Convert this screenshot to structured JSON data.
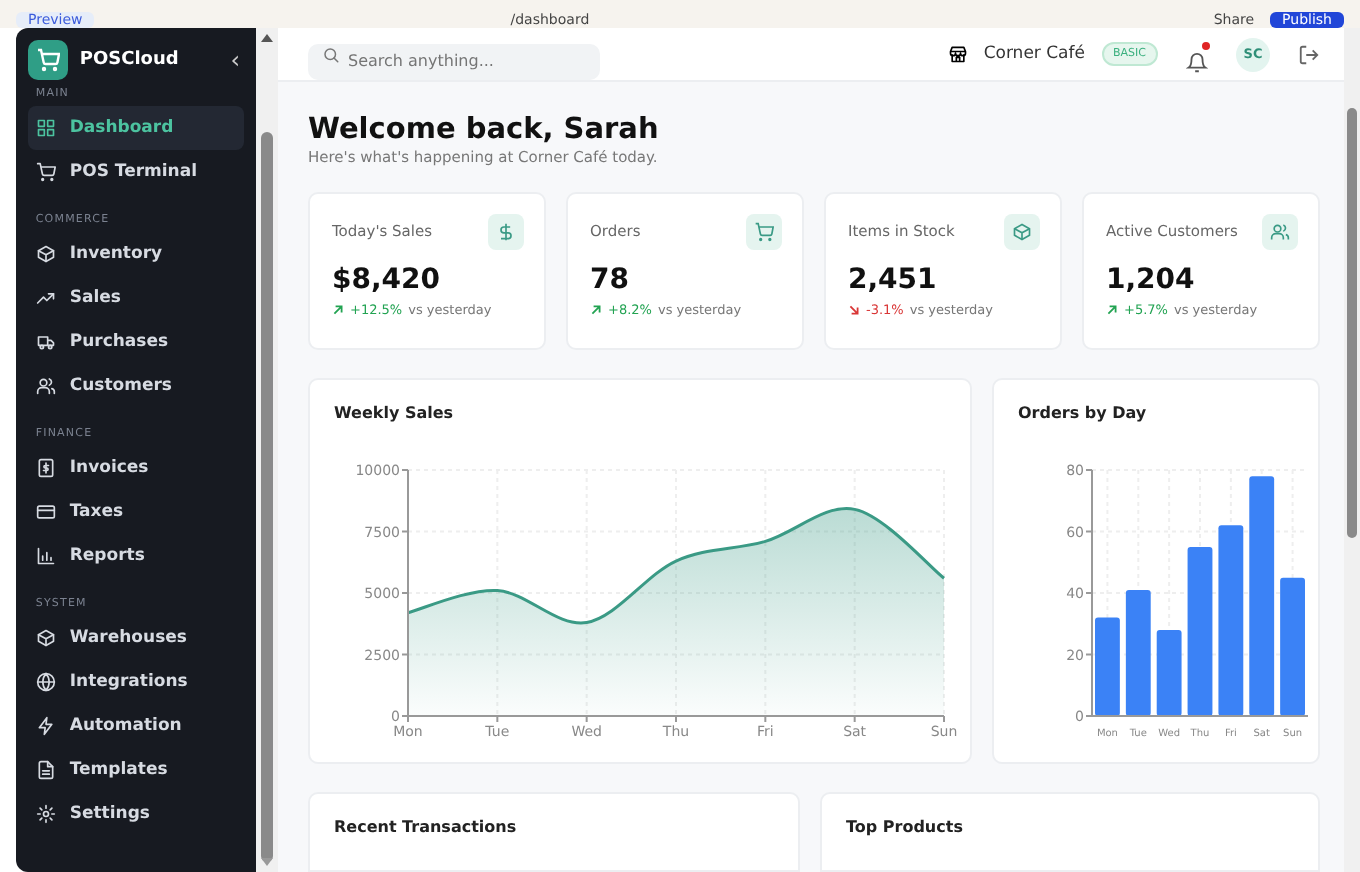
{
  "editor_bar": {
    "preview": "Preview",
    "route": "/dashboard",
    "share": "Share",
    "publish": "Publish"
  },
  "sidebar": {
    "brand": "POSCloud",
    "collapse": "‹",
    "sections": [
      {
        "title": "MAIN",
        "items": [
          {
            "label": "Dashboard",
            "selected": true
          },
          {
            "label": "POS Terminal",
            "selected": false
          }
        ]
      },
      {
        "title": "COMMERCE",
        "items": [
          {
            "label": "Inventory",
            "selected": false
          },
          {
            "label": "Sales",
            "selected": false
          },
          {
            "label": "Purchases",
            "selected": false
          },
          {
            "label": "Customers",
            "selected": false
          }
        ]
      },
      {
        "title": "FINANCE",
        "items": [
          {
            "label": "Invoices",
            "selected": false
          },
          {
            "label": "Taxes",
            "selected": false
          },
          {
            "label": "Reports",
            "selected": false
          }
        ]
      },
      {
        "title": "SYSTEM",
        "items": [
          {
            "label": "Warehouses",
            "selected": false
          },
          {
            "label": "Integrations",
            "selected": false
          },
          {
            "label": "Automation",
            "selected": false
          },
          {
            "label": "Templates",
            "selected": false
          },
          {
            "label": "Settings",
            "selected": false
          }
        ]
      }
    ]
  },
  "header": {
    "search": {
      "placeholder": "Search anything..."
    },
    "store": "Corner Café",
    "plan": "BASIC",
    "notification": true,
    "avatar": "SC"
  },
  "welcome": {
    "title": "Welcome back, Sarah",
    "subtitle": "Here's what's happening at Corner Café today."
  },
  "stats": [
    {
      "label": "Today's Sales",
      "value": "$8,420",
      "change": "+12.5%",
      "kind": "up",
      "note": "vs yesterday"
    },
    {
      "label": "Orders",
      "value": "78",
      "change": "+8.2%",
      "kind": "up",
      "note": "vs yesterday"
    },
    {
      "label": "Items in Stock",
      "value": "2,451",
      "change": "-3.1%",
      "kind": "down",
      "note": "vs yesterday"
    },
    {
      "label": "Active Customers",
      "value": "1,204",
      "change": "+5.7%",
      "kind": "up",
      "note": "vs yesterday"
    }
  ],
  "weekly_sales": {
    "title": "Weekly Sales",
    "chart_data": {
      "type": "area",
      "categories": [
        "Mon",
        "Tue",
        "Wed",
        "Thu",
        "Fri",
        "Sat",
        "Sun"
      ],
      "series": [
        {
          "color": "#3a9a85",
          "values": [
            4200,
            5100,
            3800,
            6300,
            7100,
            8400,
            5600
          ]
        }
      ],
      "ylim": [
        0,
        10000
      ],
      "yticks": [
        0,
        2500,
        5000,
        7500,
        10000
      ],
      "grid": true
    }
  },
  "orders_by_day": {
    "title": "Orders by Day",
    "chart_data": {
      "type": "bar",
      "categories": [
        "Mon",
        "Tue",
        "Wed",
        "Thu",
        "Fri",
        "Sat",
        "Sun"
      ],
      "series": [
        {
          "color": "#3b82f6",
          "values": [
            32,
            41,
            28,
            55,
            62,
            78,
            45
          ]
        }
      ],
      "ylim": [
        0,
        80
      ],
      "yticks": [
        0,
        20,
        40,
        60,
        80
      ],
      "grid": true
    }
  },
  "recent_transactions": {
    "title": "Recent Transactions"
  },
  "top_products": {
    "title": "Top Products"
  }
}
